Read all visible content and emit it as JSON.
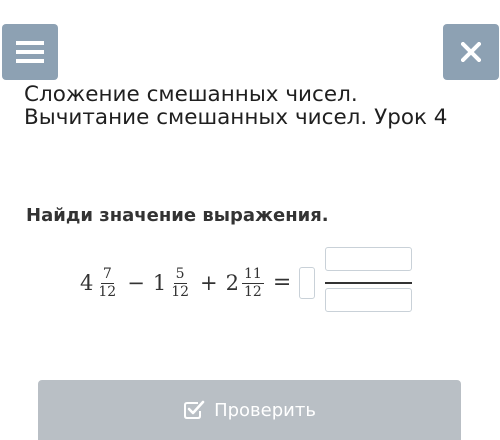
{
  "header": {
    "menu_icon": "hamburger-menu-icon",
    "close_icon": "close-icon",
    "accent_color": "#8da1b3"
  },
  "lesson": {
    "title": "Сложение смешанных чисел. Вычитание смешанных чисел. Урок 4"
  },
  "task": {
    "instruction": "Найди значение выражения.",
    "expression": {
      "terms": [
        {
          "whole": "4",
          "numerator": "7",
          "denominator": "12"
        },
        {
          "operator": "−",
          "whole": "1",
          "numerator": "5",
          "denominator": "12"
        },
        {
          "operator": "+",
          "whole": "2",
          "numerator": "11",
          "denominator": "12"
        }
      ],
      "equals": "="
    },
    "answer": {
      "whole": "",
      "numerator": "",
      "denominator": ""
    }
  },
  "footer": {
    "check_label": "Проверить",
    "check_icon": "checkbox-check-icon",
    "button_color": "#b9bfc5"
  }
}
